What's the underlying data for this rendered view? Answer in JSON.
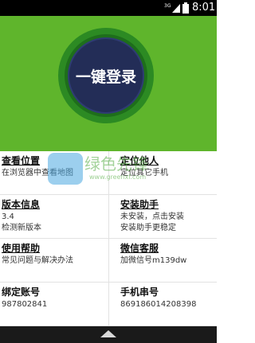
{
  "status_bar": {
    "network": "3G",
    "time": "8:01",
    "icons": [
      "signal-3g-icon",
      "battery-icon"
    ]
  },
  "hero": {
    "login_label": "一键登录",
    "colors": {
      "background": "#5fb52c",
      "ring": "#2c8a23",
      "button": "#232d57"
    }
  },
  "grid": {
    "items": [
      {
        "title": "查看位置",
        "desc1": "在浏览器中查看地图",
        "desc2": ""
      },
      {
        "title": "定位他人",
        "desc1": "定位其它手机",
        "desc2": ""
      },
      {
        "title": "版本信息",
        "desc1": "3.4",
        "desc2": "检测新版本"
      },
      {
        "title": "安装助手",
        "desc1": "未安装，点击安装",
        "desc2": "安装助手更稳定"
      },
      {
        "title": "使用帮助",
        "desc1": "常见问题与解决办法",
        "desc2": ""
      },
      {
        "title": "微信客服",
        "desc1": "加微信号m139dw",
        "desc2": ""
      },
      {
        "title": "绑定账号",
        "desc1": "987802841",
        "desc2": ""
      },
      {
        "title": "手机串号",
        "desc1": "869186014208398",
        "desc2": ""
      }
    ]
  },
  "watermark": {
    "text": "绿色先锋",
    "url": "www.greenxf.com"
  },
  "navbar": {
    "icon": "chevron-up-icon"
  }
}
